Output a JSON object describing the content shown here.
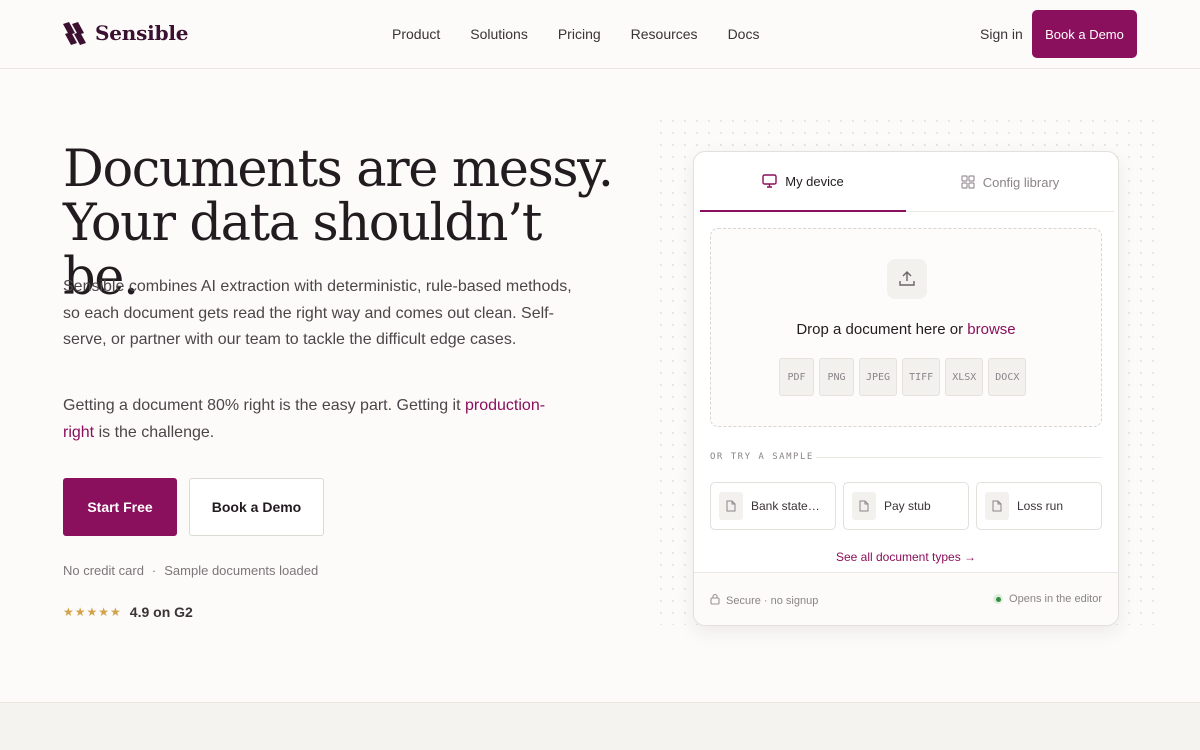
{
  "brand": {
    "name": "Sensible",
    "accent": "#8a0f5c"
  },
  "nav": {
    "items": [
      "Product",
      "Solutions",
      "Pricing",
      "Resources",
      "Docs"
    ],
    "signin": "Sign in",
    "cta": "Book a Demo"
  },
  "hero": {
    "headline_line1": "Documents are messy.",
    "headline_line2": "Your data shouldn’t be.",
    "lead": "Sensible combines AI extraction with deterministic, rule-based methods, so each document gets read the right way and comes out clean. Self-serve, or partner with our team to tackle the difficult edge cases.",
    "sub_before": "Getting a document 80% right is the easy part. Getting it ",
    "sub_link": "production-right",
    "sub_after": " is the challenge.",
    "primary_button": "Start Free",
    "secondary_button": "Book a Demo",
    "fineprint": [
      "No credit card",
      "·",
      "Sample documents loaded"
    ],
    "stars": "★★★★★",
    "rating": "4.9 on G2"
  },
  "uploader": {
    "tabs": [
      {
        "label": "My device",
        "icon": "monitor-icon",
        "active": true
      },
      {
        "label": "Config library",
        "icon": "grid-icon",
        "active": false
      }
    ],
    "drop_text": "Drop a document here or ",
    "browse": "browse",
    "formats": [
      "PDF",
      "PNG",
      "JPEG",
      "TIFF",
      "XLSX",
      "DOCX"
    ],
    "sample_heading": "OR TRY A SAMPLE",
    "samples": [
      "Bank state…",
      "Pay stub",
      "Loss run"
    ],
    "see_all": "See all document types →",
    "footer_left": "Secure · no signup",
    "footer_right": "Opens in the editor"
  }
}
